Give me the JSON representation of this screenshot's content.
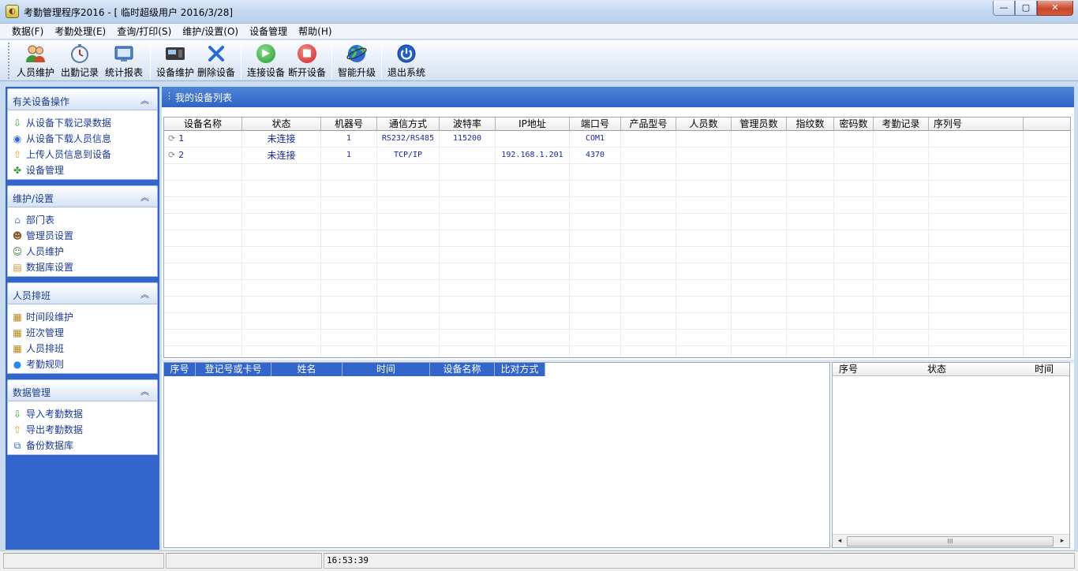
{
  "window": {
    "title": "考勤管理程序2016 - [ 临时超级用户 2016/3/28]",
    "controls": {
      "minimize": "—",
      "maximize": "▢",
      "close": "✕"
    }
  },
  "menu": [
    "数据(F)",
    "考勤处理(E)",
    "查询/打印(S)",
    "维护/设置(O)",
    "设备管理",
    "帮助(H)"
  ],
  "toolbar": {
    "staff": "人员维护",
    "attendance": "出勤记录",
    "report": "统计报表",
    "device_maint": "设备维护",
    "delete_device": "删除设备",
    "connect": "连接设备",
    "disconnect": "断开设备",
    "upgrade": "智能升级",
    "exit": "退出系统"
  },
  "sidebar": {
    "device_ops": {
      "title": "有关设备操作",
      "items": [
        "从设备下载记录数据",
        "从设备下载人员信息",
        "上传人员信息到设备",
        "设备管理"
      ]
    },
    "maintenance": {
      "title": "维护/设置",
      "items": [
        "部门表",
        "管理员设置",
        "人员维护",
        "数据库设置"
      ]
    },
    "scheduling": {
      "title": "人员排班",
      "items": [
        "时间段维护",
        "班次管理",
        "人员排班",
        "考勤规则"
      ]
    },
    "data_mgmt": {
      "title": "数据管理",
      "items": [
        "导入考勤数据",
        "导出考勤数据",
        "备份数据库"
      ]
    }
  },
  "device_list": {
    "title": "我的设备列表",
    "columns": [
      "设备名称",
      "状态",
      "机器号",
      "通信方式",
      "波特率",
      "IP地址",
      "端口号",
      "产品型号",
      "人员数",
      "管理员数",
      "指纹数",
      "密码数",
      "考勤记录",
      "序列号"
    ],
    "rows": [
      {
        "name": "1",
        "status": "未连接",
        "machine": "1",
        "comm": "RS232/RS485",
        "baud": "115200",
        "ip": "",
        "port": "COM1"
      },
      {
        "name": "2",
        "status": "未连接",
        "machine": "1",
        "comm": "TCP/IP",
        "baud": "",
        "ip": "192.168.1.201",
        "port": "4370"
      }
    ]
  },
  "records": {
    "columns": [
      "序号",
      "登记号或卡号",
      "姓名",
      "时间",
      "设备名称",
      "比对方式"
    ]
  },
  "log": {
    "columns": [
      "序号",
      "状态",
      "时间"
    ],
    "scroll_left": "◂",
    "scroll_right": "▸",
    "thumb_grip": "III"
  },
  "statusbar": {
    "time": "16:53:39"
  }
}
